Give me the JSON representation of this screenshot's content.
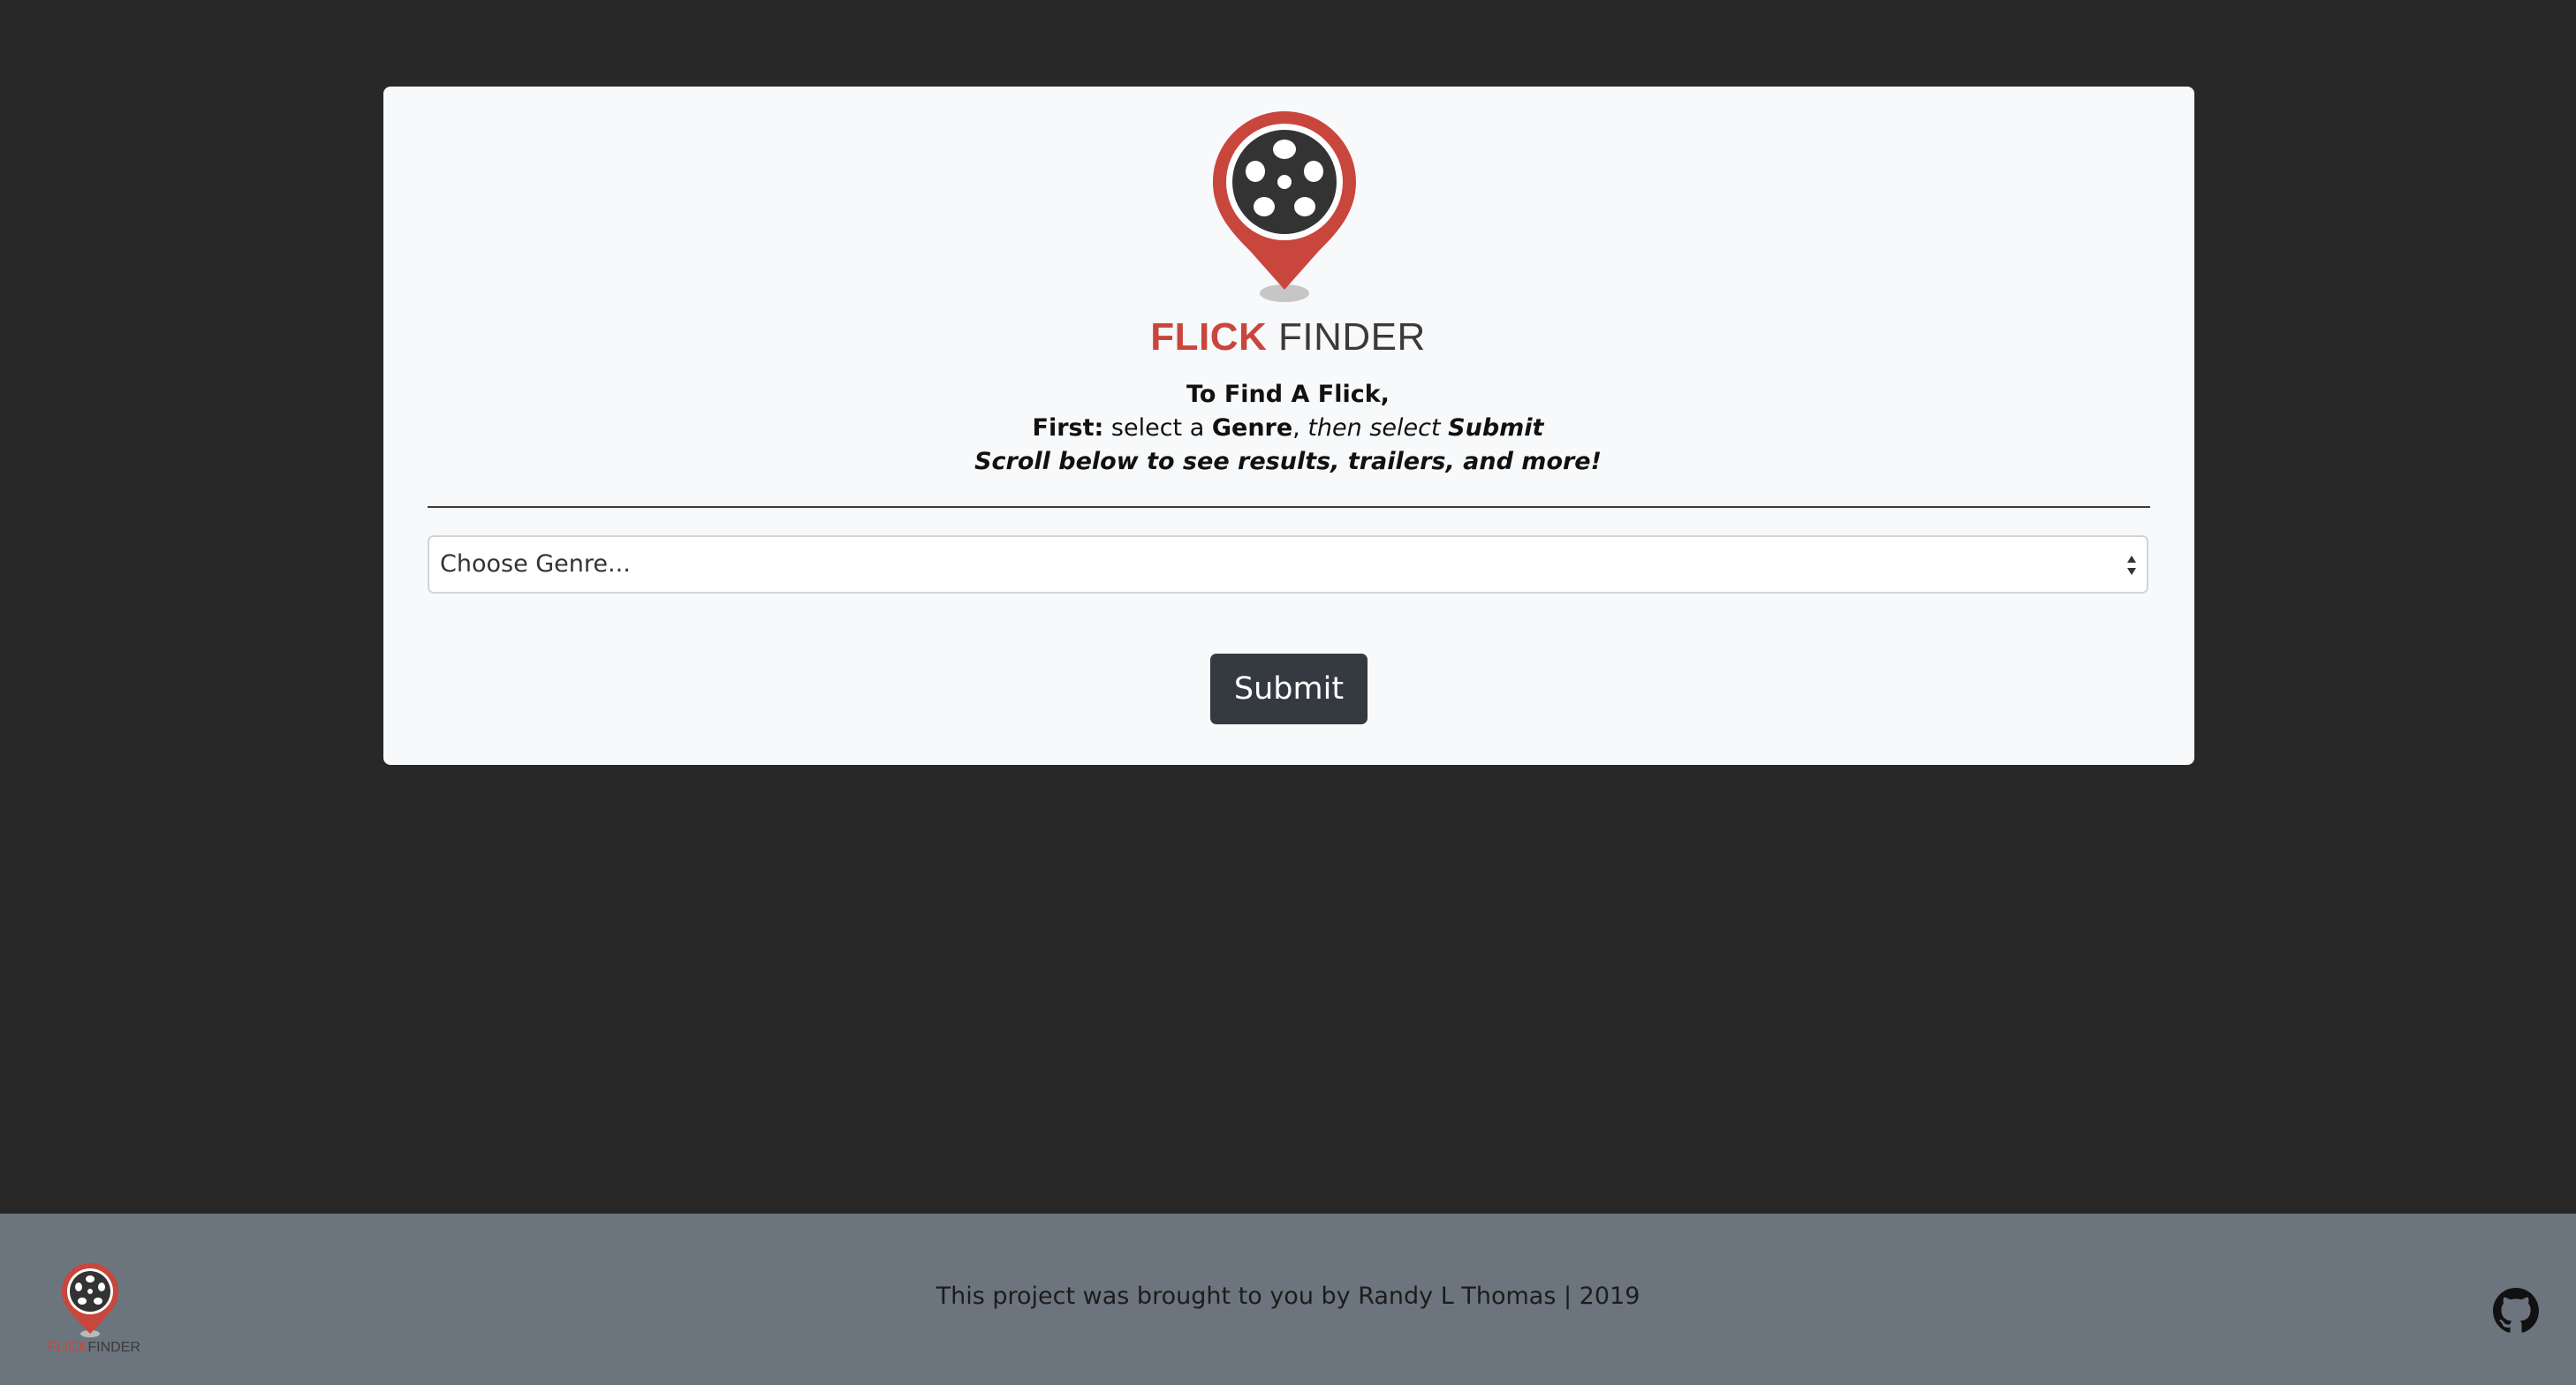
{
  "brand": {
    "name_part1": "FLICK",
    "name_part2": "FINDER"
  },
  "instructions": {
    "line1": "To Find A Flick,",
    "line2_first": "First:",
    "line2_select_a": " select a ",
    "line2_genre": "Genre",
    "line2_comma": ",",
    "line2_then_select": " then select ",
    "line2_submit": "Submit",
    "line3": "Scroll below to see results, trailers, and more!"
  },
  "genre_select": {
    "selected": "Choose Genre..."
  },
  "submit_button": {
    "label": "Submit"
  },
  "footer": {
    "logo_part1": "FLICK",
    "logo_part2": "FINDER",
    "text": "This project was brought to you by Randy L Thomas | 2019",
    "github_icon": "github-icon"
  },
  "colors": {
    "page_background": "#282828",
    "card_background": "#f8f9fa",
    "brand_red": "#c9463d",
    "button_dark": "#343a40",
    "footer_background": "#6c757d"
  }
}
